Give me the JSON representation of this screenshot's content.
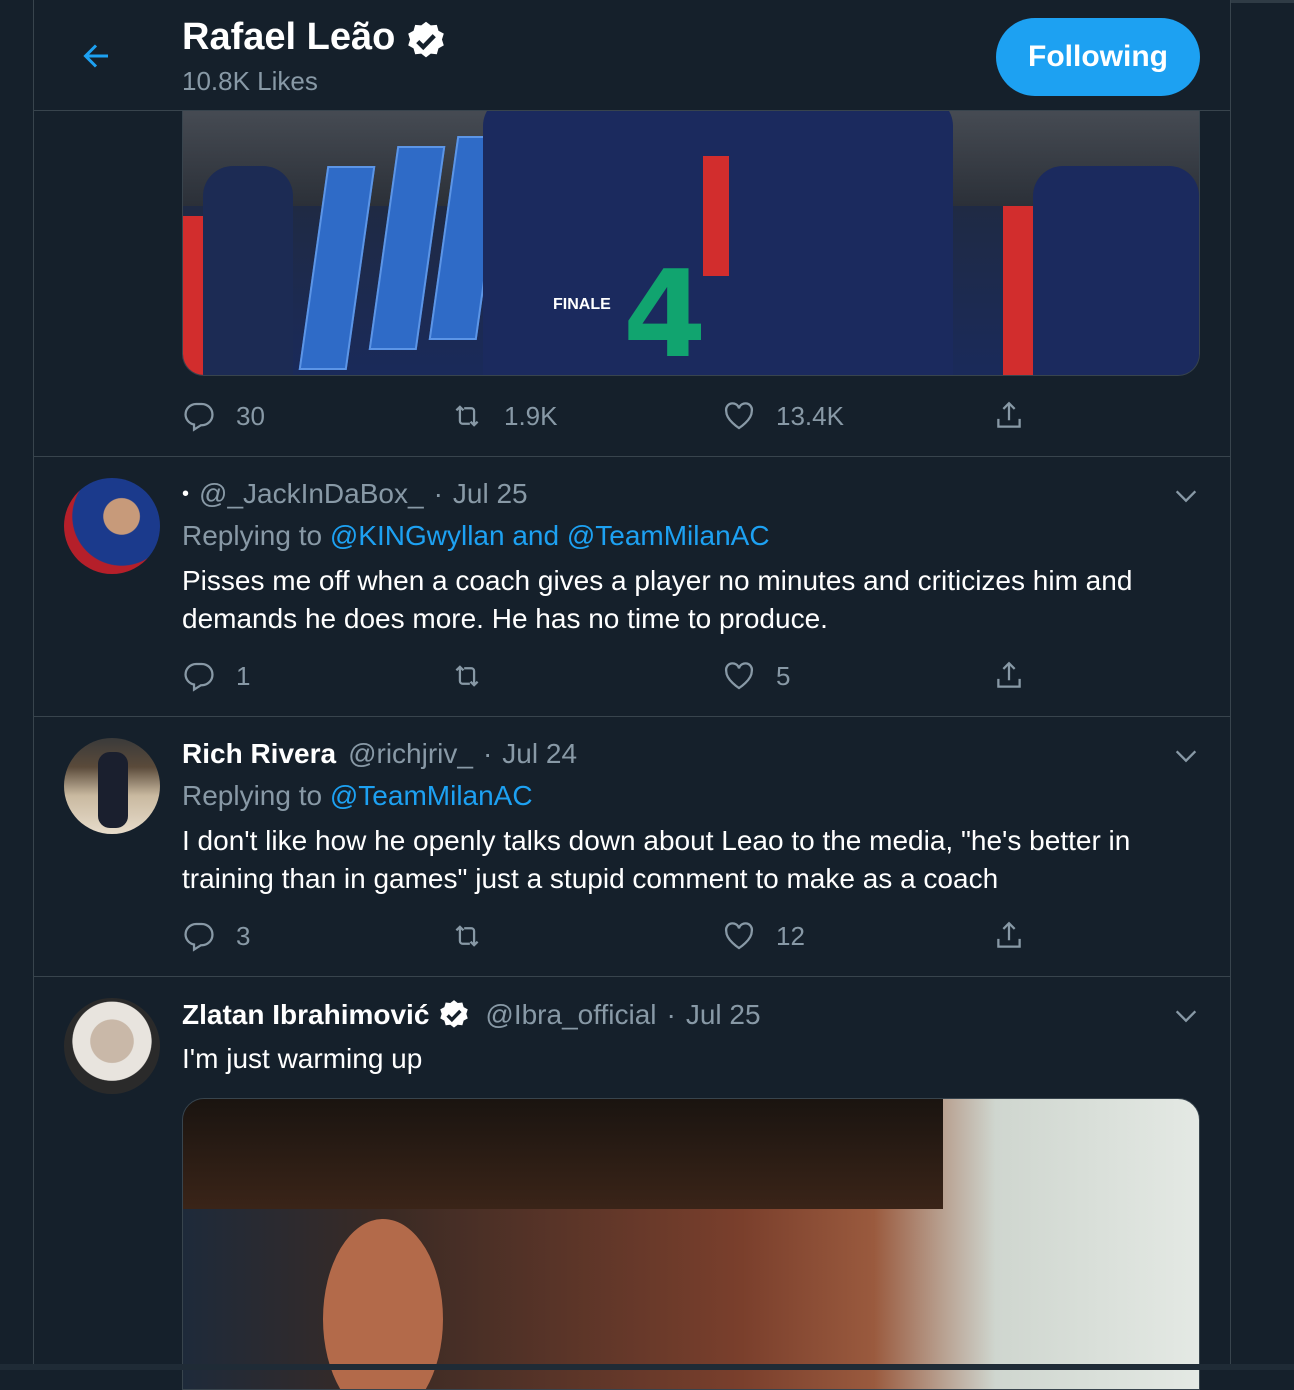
{
  "header": {
    "name": "Rafael Leão",
    "likes": "10.8K Likes",
    "follow_button": "Following"
  },
  "tweet_media_1": {
    "finale_text": "FINALE",
    "logo_text": "4"
  },
  "tweet_1_actions": {
    "replies": "30",
    "retweets": "1.9K",
    "likes": "13.4K"
  },
  "reply_1": {
    "lead_dot": "•",
    "handle": "@_JackInDaBox_",
    "separator": "·",
    "date": "Jul 25",
    "replying_prefix": "Replying to",
    "mentions": "@KINGwyllan and @TeamMilanAC",
    "text": "Pisses me off when a coach gives a player no minutes and criticizes him and demands he does more. He has no time to produce.",
    "replies": "1",
    "retweets": "",
    "likes": "5"
  },
  "reply_2": {
    "name": "Rich Rivera",
    "handle": "@richjriv_",
    "separator": "·",
    "date": "Jul 24",
    "replying_prefix": "Replying to",
    "mentions": "@TeamMilanAC",
    "text": "I don't like how he openly talks down about Leao to the media, \"he's better in training than in games\" just a stupid comment to make as a coach",
    "replies": "3",
    "retweets": "",
    "likes": "12"
  },
  "tweet_3": {
    "name": "Zlatan Ibrahimović",
    "handle": "@Ibra_official",
    "separator": "·",
    "date": "Jul 25",
    "text": "I'm just warming up"
  },
  "colors": {
    "background": "#15202b",
    "border": "#38444d",
    "accent": "#1da1f2",
    "secondary_text": "#8899a6"
  },
  "icons": [
    "back-arrow-icon",
    "verified-badge-icon",
    "reply-icon",
    "retweet-icon",
    "like-icon",
    "share-icon",
    "chevron-down-icon"
  ]
}
